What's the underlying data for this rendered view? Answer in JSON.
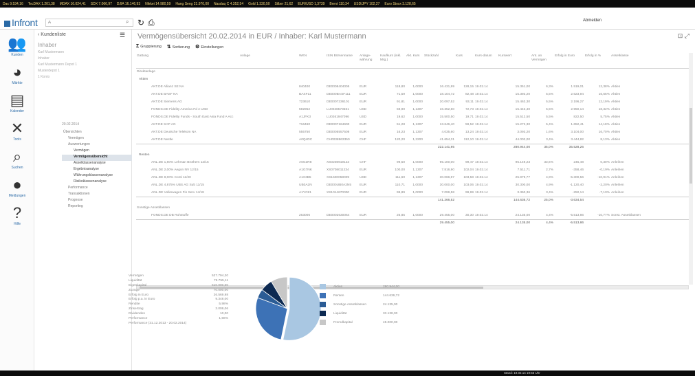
{
  "ticker": [
    "Dax 9.534,16",
    "TecDAX 1.201,38",
    "MDAX 16.024,41",
    "SDX 7.066,97",
    "DJIA 16.146,93",
    "Nikkei 14.980,59",
    "Hang Seng 21.970,00",
    "Nasdaq C 4.352,54",
    "Gold 1.330,50",
    "Silber 21,62",
    "EUR/USD 1,3739",
    "Brent 110,34",
    "USD/JPY 102,27",
    "Euro Stoxx 3.128,65"
  ],
  "toolbar": {
    "logo": "Infront",
    "search_placeholder": "A",
    "logout_label": "Abmelden"
  },
  "leftnav": [
    {
      "label": "Kunden",
      "icon": "group-icon",
      "glyph": "👥"
    },
    {
      "label": "Märkte",
      "icon": "pie-chart-icon",
      "glyph": "◕"
    },
    {
      "label": "Kalender",
      "icon": "calendar-icon",
      "glyph": "▤"
    },
    {
      "label": "Tools",
      "icon": "tools-icon",
      "glyph": "✕"
    },
    {
      "label": "Suchen",
      "icon": "search-icon",
      "glyph": "⌕"
    },
    {
      "label": "Meldungen",
      "icon": "alert-icon",
      "glyph": "●"
    },
    {
      "label": "Hilfe",
      "icon": "help-icon",
      "glyph": "?"
    }
  ],
  "sidebar": {
    "back_label": "Kundenliste",
    "title": "Inhaber",
    "lines": [
      "Karl Mustermann",
      "Inhaber",
      "Karl Mustermann Depot 1",
      "Musterdepot 1",
      "1 Konto"
    ],
    "date": "20.02.2014",
    "tree": [
      {
        "label": "Übersichten",
        "level": 0,
        "selected": false
      },
      {
        "label": "Vermögen",
        "level": 1,
        "selected": false
      },
      {
        "label": "Auswertungen",
        "level": 1,
        "selected": false
      },
      {
        "label": "Vermögen",
        "level": 2,
        "selected": false
      },
      {
        "label": "Vermögensübersicht",
        "level": 2,
        "selected": true
      },
      {
        "label": "Assetklassenanalyse",
        "level": 2,
        "selected": false
      },
      {
        "label": "Ergebnisanalyse",
        "level": 2,
        "selected": false
      },
      {
        "label": "Währungsklassenanalyse",
        "level": 2,
        "selected": false
      },
      {
        "label": "Risikoklassenanalyse",
        "level": 2,
        "selected": false
      },
      {
        "label": "Performance",
        "level": 1,
        "selected": false
      },
      {
        "label": "Transaktionen",
        "level": 1,
        "selected": false
      },
      {
        "label": "Prognose",
        "level": 1,
        "selected": false
      },
      {
        "label": "Reporting",
        "level": 1,
        "selected": false
      }
    ]
  },
  "main": {
    "title": "Vermögensübersicht 20.02.2014 in EUR / Inhaber: Karl Mustermann",
    "subtoolbar": [
      {
        "label": "Gruppierung",
        "icon": "sigma-icon",
        "glyph": "Σ"
      },
      {
        "label": "Sortierung",
        "icon": "sort-icon",
        "glyph": "⇅"
      },
      {
        "label": "Einstellungen",
        "icon": "settings-icon",
        "glyph": "⚙"
      }
    ],
    "columns": [
      "Gattung",
      "Anlage",
      "WKN",
      "ISIN Börsenname",
      "Anlage-währung",
      "Kaufkurs (inkl. Mrg.)",
      "Akt. Kurs",
      "Stückzahl",
      "Kurs",
      "Kurs-datum",
      "Kurswert",
      "Ant. an Vermögen",
      "Erfolg in Euro",
      "Erfolg in %",
      "Assetklasse"
    ],
    "rows": [
      {
        "type": "group",
        "cells": [
          "Direktanlage"
        ]
      },
      {
        "type": "sub",
        "cells": [
          "Aktien"
        ]
      },
      {
        "type": "row",
        "cells": [
          "AKT.DE Allianz SE NA",
          "",
          "840400",
          "DE0008404005",
          "EUR",
          "118,80",
          "1,0000",
          "16.431,99",
          "128,15",
          "19.02.14",
          "15.351,00",
          "6,3%",
          "1.519,01",
          "12,38%",
          "Aktien"
        ]
      },
      {
        "type": "row",
        "cells": [
          "AKT.DE BASF NA",
          "",
          "BASF11",
          "DE000BASF111",
          "EUR",
          "71,59",
          "1,0000",
          "18.104,72",
          "82,48",
          "19.02.14",
          "15.393,20",
          "5,5%",
          "2.623,94",
          "16,65%",
          "Aktien"
        ]
      },
      {
        "type": "row",
        "cells": [
          "AKT.DE Siemens AG",
          "",
          "723610",
          "DE0007236101",
          "EUR",
          "91,81",
          "1,0000",
          "20.097,52",
          "93,11",
          "19.02.14",
          "15.463,30",
          "5,5%",
          "2.196,27",
          "12,19%",
          "Aktien"
        ]
      },
      {
        "type": "row",
        "cells": [
          "FONDS.DE Fidelity America Fd A USD",
          "",
          "592952",
          "LU0048573561",
          "USD",
          "59,90",
          "1,1307",
          "16.352,60",
          "72,73",
          "19.02.14",
          "15.443,40",
          "5,5%",
          "2.950,14",
          "18,32%",
          "Aktien"
        ]
      },
      {
        "type": "row",
        "cells": [
          "FONDS.DE Fidelity Funds - South East Asia Fund A Acc",
          "",
          "A1JFK3",
          "LU0261947096",
          "USD",
          "19,62",
          "1,0000",
          "15.500,50",
          "19,71",
          "19.02.14",
          "15.512,50",
          "5,5%",
          "822,50",
          "5,75%",
          "Aktien"
        ]
      },
      {
        "type": "row",
        "cells": [
          "AKT.DE SAP AG",
          "",
          "716460",
          "DE0007164600",
          "EUR",
          "51,28",
          "1,1307",
          "13.646,40",
          "59,52",
          "19.02.14",
          "15.272,30",
          "5,4%",
          "1.652,41",
          "14,18%",
          "Aktien"
        ]
      },
      {
        "type": "row",
        "cells": [
          "AKT.DE Deutsche Telekom NA",
          "",
          "555750",
          "DE0005557508",
          "EUR",
          "16,23",
          "1,1307",
          "4.035,60",
          "13,24",
          "19.02.14",
          "3.093,20",
          "1,6%",
          "3.104,00",
          "16,70%",
          "Aktien"
        ]
      },
      {
        "type": "row",
        "cells": [
          "AKT.DE Nestle",
          "",
          "A0Q4DC",
          "CH0038863350",
          "CHF",
          "120,20",
          "1,2200",
          "41.654,31",
          "112,10",
          "19.02.14",
          "44.002,00",
          "3,4%",
          "3.444,82",
          "8,13%",
          "Aktien"
        ]
      },
      {
        "type": "sum",
        "cells": [
          "",
          "",
          "",
          "",
          "",
          "",
          "",
          "222.141,95",
          "",
          "",
          "280.944,00",
          "35,0%",
          "35.528,26",
          "",
          ""
        ]
      },
      {
        "type": "sub",
        "cells": [
          "Renten"
        ]
      },
      {
        "type": "row",
        "cells": [
          "ANL.DE 1,60% Lehman Brothers 12/15",
          "",
          "A0G3R8",
          "XS0208919123",
          "CHF",
          "99,50",
          "1,0000",
          "95.100,00",
          "99,47",
          "19.02.14",
          "95.149,23",
          "33,6%",
          "245,48",
          "0,30%",
          "Anleihen"
        ]
      },
      {
        "type": "row",
        "cells": [
          "ANL.DE 2,00% Aegon NV 12/15",
          "",
          "A1G7NK",
          "XS0708011234",
          "EUR",
          "100,00",
          "1,1307",
          "7.816,90",
          "102,04",
          "19.02.14",
          "7.511,71",
          "2,7%",
          "-358,46",
          "-0,19%",
          "Anleihen"
        ]
      },
      {
        "type": "row",
        "cells": [
          "ANL.DE 8,00% Conti 11/20",
          "",
          "A1X3B5",
          "XS1500058009",
          "USD",
          "111,60",
          "1,1307",
          "30.066,97",
          "103,58",
          "19.02.14",
          "25.979,77",
          "4,9%",
          "-5.300,56",
          "-10,91%",
          "Anleihen"
        ]
      },
      {
        "type": "row",
        "cells": [
          "ANL.DE 4,875% UBS AG Sub 11/15",
          "",
          "UB0A2N",
          "DE000UB0A2N5",
          "EUR",
          "110,71",
          "1,0000",
          "30.000,00",
          "103,06",
          "19.02.14",
          "30.300,00",
          "4,9%",
          "-1.120,40",
          "-2,20%",
          "Anleihen"
        ]
      },
      {
        "type": "row",
        "cells": [
          "ANL.DE Volkswagen Fin Serv 14/18",
          "",
          "A1YC81",
          "XS1014670000",
          "EUR",
          "99,89",
          "1,0000",
          "7.099,58",
          "99,99",
          "19.02.14",
          "3.360,36",
          "3,4%",
          "-250,14",
          "-7,10%",
          "Anleihen"
        ]
      },
      {
        "type": "sum",
        "cells": [
          "",
          "",
          "",
          "",
          "",
          "",
          "",
          "141.266,52",
          "",
          "",
          "144.636,72",
          "25,0%",
          "-3.634,54",
          "",
          ""
        ]
      },
      {
        "type": "group",
        "cells": [
          "Sonstige Assetklassen"
        ]
      },
      {
        "type": "row",
        "cells": [
          "FONDS.DE DB Rohstoffe",
          "",
          "263006",
          "DE0002630064",
          "EUR",
          "26,85",
          "1,0000",
          "29.455,00",
          "30,30",
          "19.02.14",
          "24.135,00",
          "4,4%",
          "-5.513,86",
          "-10,77%",
          "Sonst. Assetklassen"
        ]
      },
      {
        "type": "sum",
        "cells": [
          "",
          "",
          "",
          "",
          "",
          "",
          "",
          "29.455,00",
          "",
          "",
          "24.135,00",
          "4,4%",
          "-5.513,86",
          "",
          ""
        ]
      }
    ]
  },
  "summary": [
    {
      "label": "Vermögen",
      "value": "527.794,20"
    },
    {
      "label": "Liquidität",
      "value": "76.755,11"
    },
    {
      "label": "Eigenkapital",
      "value": "510.000,00"
    },
    {
      "label": "Zuzüge",
      "value": "70.000,00"
    },
    {
      "label": "Erfolg in Euro",
      "value": "26.569,98"
    },
    {
      "label": "Erfolg p.a. in Euro",
      "value": "9.348,00"
    },
    {
      "label": "Rendite",
      "value": "5,98%"
    },
    {
      "label": "Zinsertrag",
      "value": "3.008,06"
    },
    {
      "label": "Dividenden",
      "value": "10,00"
    },
    {
      "label": "Performance",
      "value": "1,56%"
    },
    {
      "label": "Performance (31.12.2013 - 20.02.2014)",
      "value": ""
    }
  ],
  "pie": [
    {
      "name": "Aktien",
      "value": 280944.0,
      "amount": "280.944,00",
      "color": "#a9c7e2"
    },
    {
      "name": "Renten",
      "value": 144636.72,
      "amount": "144.636,72",
      "color": "#3d72b6"
    },
    {
      "name": "Sonstige Assetklassen",
      "value": 24135.0,
      "amount": "24.135,00",
      "color": "#2b5c95"
    },
    {
      "name": "Liquidität",
      "value": 33138.0,
      "amount": "33.138,00",
      "color": "#0d2a52"
    },
    {
      "name": "Fremdkapital",
      "value": 45000.0,
      "amount": "45.000,00",
      "color": "#c7c7c7"
    }
  ],
  "status": "Stand: 19.02.14 19:55 Uhr"
}
